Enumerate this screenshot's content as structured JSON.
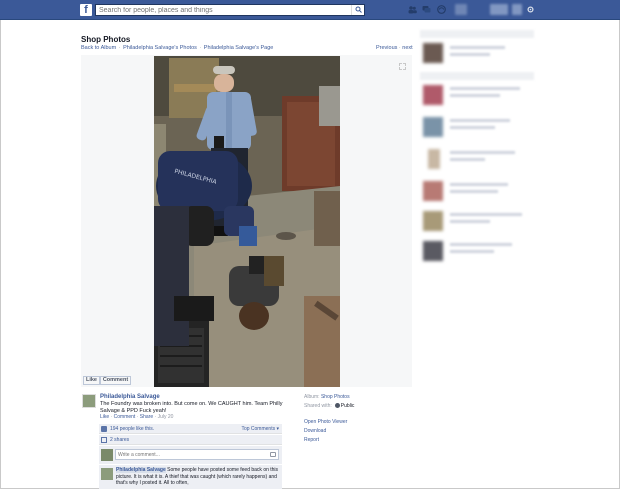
{
  "topbar": {
    "logo": "f",
    "search_placeholder": "Search for people, places and things",
    "icons": [
      "friend-requests-icon",
      "messages-icon",
      "notifications-icon"
    ],
    "accent": "#3b5998"
  },
  "page": {
    "title": "Shop Photos",
    "breadcrumb": [
      "Back to Album",
      "Philadelphia Salvage's Photos",
      "Philadelphia Salvage's Page"
    ],
    "prev": "Previous",
    "next": "next"
  },
  "photo_actions": {
    "like": "Like",
    "comment": "Comment"
  },
  "post": {
    "author": "Philadelphia Salvage",
    "text": "The Foundry was broken into. But come on. We CAUGHT him. Team Philly Salvage & PPD Fuck yeah!",
    "meta_like": "Like",
    "meta_comment": "Comment",
    "meta_share": "Share",
    "meta_date": "July 20",
    "likes": "194 people like this.",
    "top_comments": "Top Comments",
    "shares": "2 shares",
    "write_placeholder": "Write a comment...",
    "reply_author": "Philadelphia Salvage",
    "reply_text": "Some people have posted some feed back on this picture. It is what it is. A thief that was caught (which rarely happens) and that's why I posted it. All to often,"
  },
  "info": {
    "album_label": "Album:",
    "album_value": "Shop Photos",
    "shared_label": "Shared with:",
    "shared_value": "Public",
    "open_viewer": "Open Photo Viewer",
    "download": "Download",
    "report": "Report"
  },
  "colors": {
    "link": "#3b5998",
    "stage_bg": "#f6f7f8",
    "comment_bg": "#edeff4"
  }
}
